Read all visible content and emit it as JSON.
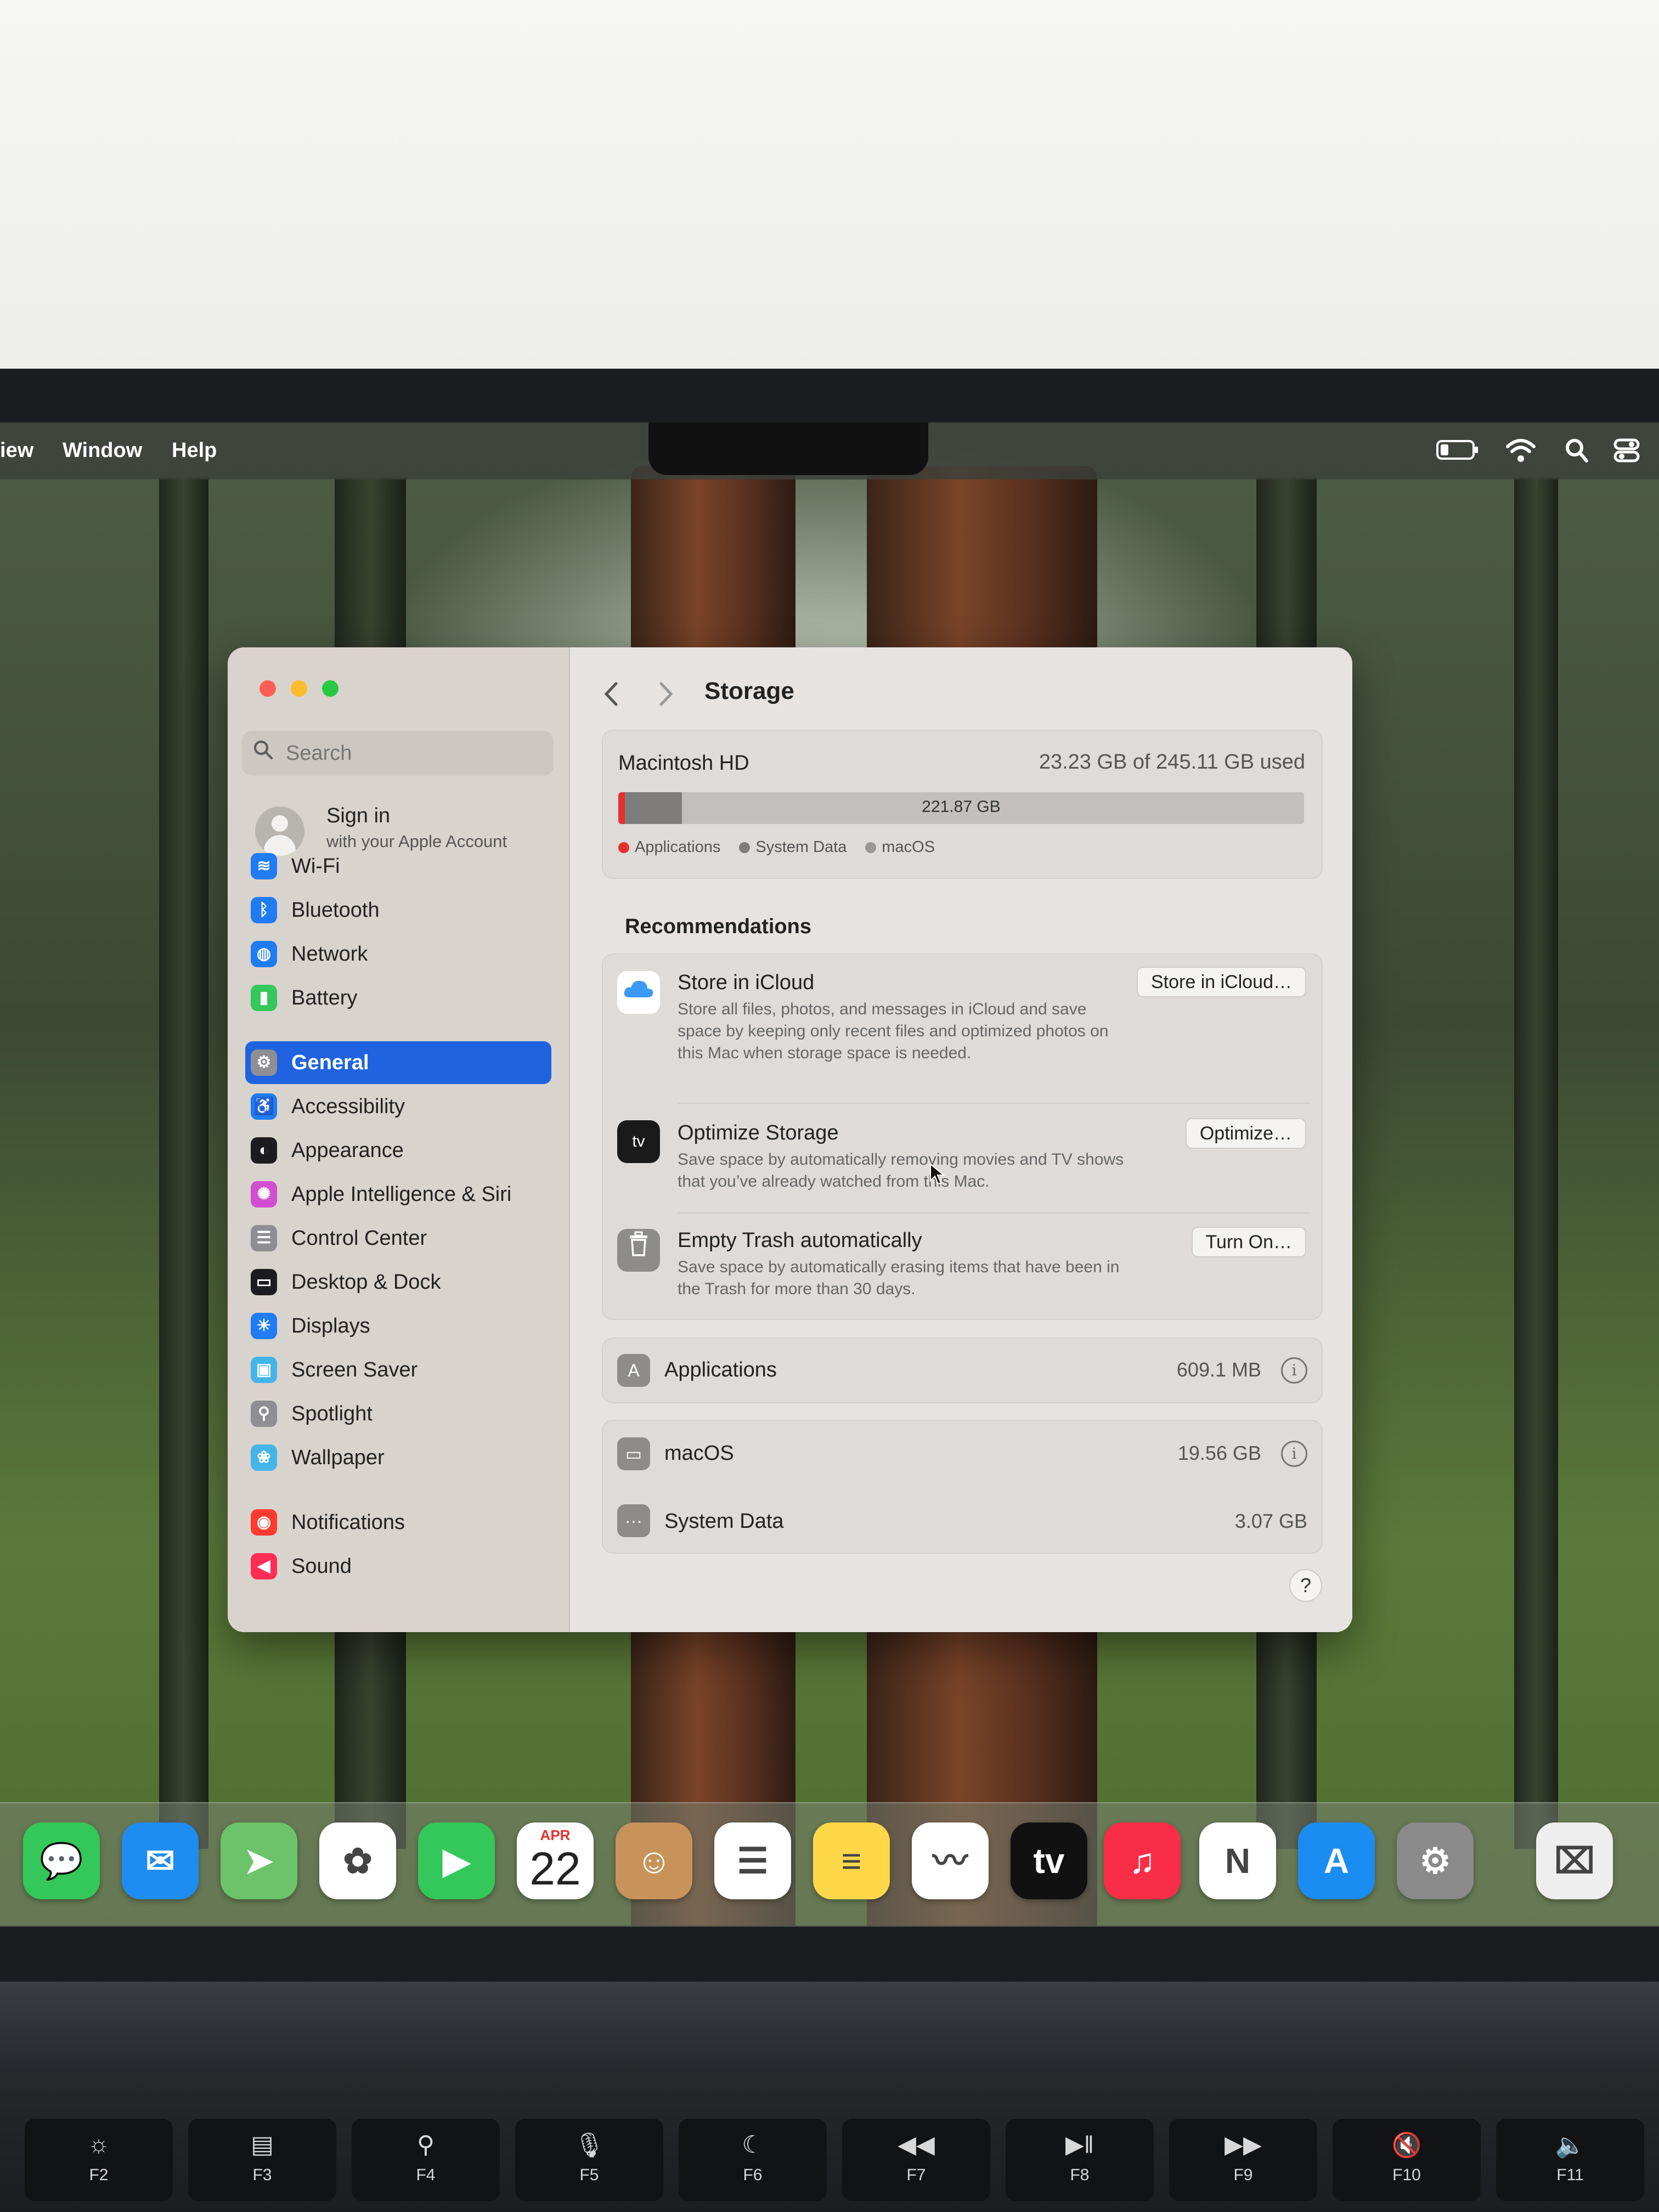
{
  "menubar": {
    "items": [
      "iew",
      "Window",
      "Help"
    ]
  },
  "sidebar": {
    "search_placeholder": "Search",
    "account": {
      "title": "Sign in",
      "subtitle": "with your Apple Account"
    },
    "items": [
      {
        "label": "Wi-Fi",
        "icon": "wifi-icon",
        "color": "#1f7cf2"
      },
      {
        "label": "Bluetooth",
        "icon": "bluetooth-icon",
        "color": "#1f7cf2"
      },
      {
        "label": "Network",
        "icon": "globe-icon",
        "color": "#1f7cf2"
      },
      {
        "label": "Battery",
        "icon": "battery-icon",
        "color": "#34c759"
      },
      {
        "label": "General",
        "icon": "gear-icon",
        "color": "#8e8e93",
        "active": true
      },
      {
        "label": "Accessibility",
        "icon": "accessibility-icon",
        "color": "#1f7cf2"
      },
      {
        "label": "Appearance",
        "icon": "appearance-icon",
        "color": "#1c1c1e"
      },
      {
        "label": "Apple Intelligence & Siri",
        "icon": "siri-icon",
        "color": "#d04fd0"
      },
      {
        "label": "Control Center",
        "icon": "control-center-icon",
        "color": "#8e8e93"
      },
      {
        "label": "Desktop & Dock",
        "icon": "desktop-dock-icon",
        "color": "#1c1c1e"
      },
      {
        "label": "Displays",
        "icon": "displays-icon",
        "color": "#1f7cf2"
      },
      {
        "label": "Screen Saver",
        "icon": "screen-saver-icon",
        "color": "#45b5e8"
      },
      {
        "label": "Spotlight",
        "icon": "spotlight-icon",
        "color": "#8e8e93"
      },
      {
        "label": "Wallpaper",
        "icon": "wallpaper-icon",
        "color": "#45b5e8"
      },
      {
        "label": "Notifications",
        "icon": "notifications-icon",
        "color": "#ff3b30"
      },
      {
        "label": "Sound",
        "icon": "sound-icon",
        "color": "#ff2d55"
      }
    ]
  },
  "content": {
    "title": "Storage",
    "disk": {
      "name": "Macintosh HD",
      "used": "23.23 GB of 245.11 GB used",
      "bar_label": "221.87 GB",
      "legend": [
        {
          "label": "Applications",
          "color": "#e5322d"
        },
        {
          "label": "System Data",
          "color": "#7f7d7b"
        },
        {
          "label": "macOS",
          "color": "#9a9896"
        }
      ]
    },
    "recommendations_title": "Recommendations",
    "recommendations": [
      {
        "title": "Store in iCloud",
        "desc": "Store all files, photos, and messages in iCloud and save space by keeping only recent files and optimized photos on this Mac when storage space is needed.",
        "button": "Store in iCloud…",
        "icon": "icloud-icon"
      },
      {
        "title": "Optimize Storage",
        "desc": "Save space by automatically removing movies and TV shows that you’ve already watched from this Mac.",
        "button": "Optimize…",
        "icon": "appletv-icon"
      },
      {
        "title": "Empty Trash automatically",
        "desc": "Save space by automatically erasing items that have been in the Trash for more than 30 days.",
        "button": "Turn On…",
        "icon": "trash-icon"
      }
    ],
    "rows": [
      {
        "label": "Applications",
        "size": "609.1 MB",
        "icon": "applications-icon"
      },
      {
        "label": "macOS",
        "size": "19.56 GB",
        "icon": "laptop-icon"
      },
      {
        "label": "System Data",
        "size": "3.07 GB",
        "icon": "ellipsis-icon"
      }
    ],
    "help": "?"
  },
  "dock": {
    "apps": [
      {
        "name": "messages-app",
        "color": "#34c759",
        "glyph": "💬"
      },
      {
        "name": "mail-app",
        "color": "#1e8cf0",
        "glyph": "✉"
      },
      {
        "name": "maps-app",
        "color": "#6cc36a",
        "glyph": "➤"
      },
      {
        "name": "photos-app",
        "color": "#ffffff",
        "glyph": "✿"
      },
      {
        "name": "facetime-app",
        "color": "#34c759",
        "glyph": "▶"
      },
      {
        "name": "calendar-app",
        "color": "#ffffff",
        "glyph": ""
      },
      {
        "name": "contacts-app",
        "color": "#c8935a",
        "glyph": "☺"
      },
      {
        "name": "reminders-app",
        "color": "#ffffff",
        "glyph": "☰"
      },
      {
        "name": "notes-app",
        "color": "#ffd84a",
        "glyph": "≡"
      },
      {
        "name": "freeform-app",
        "color": "#ffffff",
        "glyph": "〰"
      },
      {
        "name": "tv-app",
        "color": "#111111",
        "glyph": "tv"
      },
      {
        "name": "music-app",
        "color": "#fa2d48",
        "glyph": "♫"
      },
      {
        "name": "news-app",
        "color": "#ffffff",
        "glyph": "N"
      },
      {
        "name": "app-store-app",
        "color": "#1b8cf2",
        "glyph": "A"
      },
      {
        "name": "system-settings-app",
        "color": "#8a8a8a",
        "glyph": "⚙"
      },
      {
        "name": "utility-app",
        "color": "#eeeeee",
        "glyph": "⌧"
      }
    ],
    "calendar": {
      "month": "APR",
      "day": "22"
    }
  },
  "keyboard": {
    "keys": [
      {
        "symbol": "☼",
        "label": "F2"
      },
      {
        "symbol": "▤",
        "label": "F3"
      },
      {
        "symbol": "⚲",
        "label": "F4"
      },
      {
        "symbol": "🎙",
        "label": "F5"
      },
      {
        "symbol": "☾",
        "label": "F6"
      },
      {
        "symbol": "◀◀",
        "label": "F7"
      },
      {
        "symbol": "▶‖",
        "label": "F8"
      },
      {
        "symbol": "▶▶",
        "label": "F9"
      },
      {
        "symbol": "🔇",
        "label": "F10"
      },
      {
        "symbol": "🔈",
        "label": "F11"
      }
    ]
  }
}
